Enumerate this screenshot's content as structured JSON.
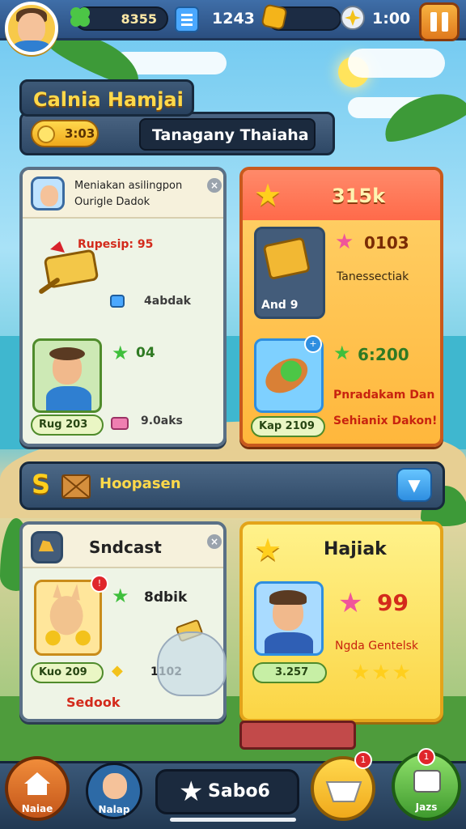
{
  "topbar": {
    "gems_value": "8355",
    "middle_value": "1243",
    "timer_value": "1:00"
  },
  "header": {
    "title": "Calnia Hamjai",
    "coins_value": "3:03",
    "search_text": "Tanagany Thaiaha"
  },
  "card_left_top": {
    "heading_line1": "Meniakan asilingpon",
    "heading_line2": "Ourigle Dadok",
    "reward_label": "Rupesip: 95",
    "item_value": "4abdak",
    "star_value": "04",
    "tag_label": "Rug 203",
    "gift_value": "9.0aks"
  },
  "card_right_top": {
    "title": "315k",
    "stat1_value": "0103",
    "stat1_label": "Tanessectiak",
    "item_tag": "And 9",
    "stat2_value": "6:200",
    "stat2_label_line1": "Pnradakam Dan",
    "stat2_label_line2": "Sehianix Dakon!",
    "tag_label": "Kap 2109"
  },
  "section_bar": {
    "label": "Hoopasen",
    "s_letter": "S"
  },
  "card_left_bottom": {
    "title": "Sndcast",
    "stat1_value": "8dbik",
    "tag_label": "Kuo 209",
    "stat2_value": "1102",
    "footer_label": "Sedook"
  },
  "card_right_bottom": {
    "title": "Hajiak",
    "score_value": "99",
    "score_label": "Ngda Gentelsk",
    "tag_label": "3.257"
  },
  "bottom_nav": {
    "home_label": "Naiae",
    "profile_label": "Nalap",
    "center_label": "Sabo6",
    "center_badge": "1",
    "shop_label": "Jazs",
    "card_badge": "1"
  },
  "colors": {
    "accent_gold": "#ffd94a",
    "topbar_blue": "#3f6ea8",
    "orange_card": "#ffb73c",
    "yellow_card": "#fbd545",
    "green_star": "#3fbf3c",
    "pink_star": "#f0559a",
    "red_text": "#d32a1b"
  }
}
